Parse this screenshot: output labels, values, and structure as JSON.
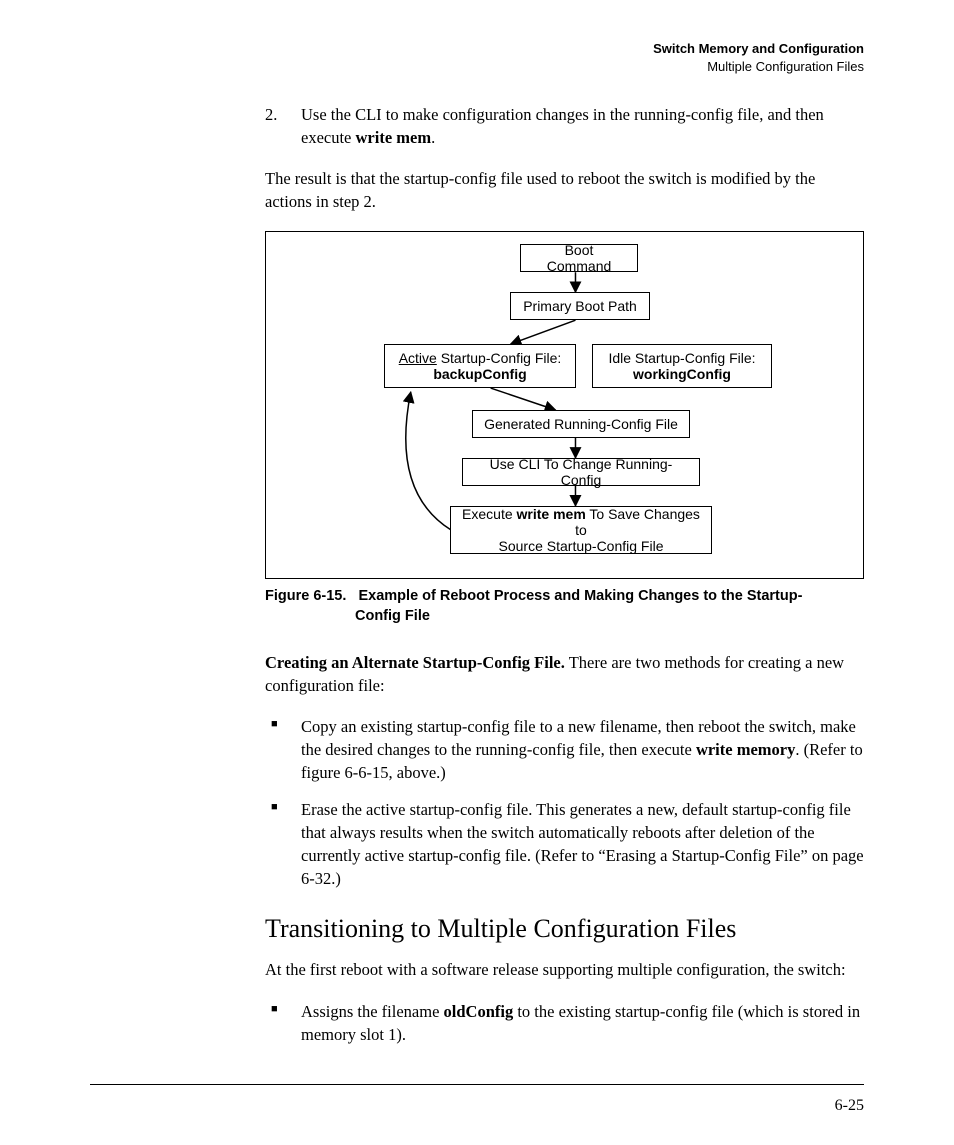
{
  "header": {
    "title_bold": "Switch Memory and Configuration",
    "subtitle": "Multiple Configuration Files"
  },
  "step2": {
    "num": "2.",
    "text_a": "Use the CLI to make configuration changes in the running-config file, and then execute ",
    "bold": "write mem",
    "text_b": "."
  },
  "result_para": "The result is that the startup-config file used to reboot the switch is modified by the actions in step 2.",
  "diagram": {
    "boot_command": "Boot Command",
    "primary_boot_path": "Primary Boot Path",
    "active_label_pre": "Active",
    "active_label_post": " Startup-Config File:",
    "active_name": "backupConfig",
    "idle_label": "Idle Startup-Config File:",
    "idle_name": "workingConfig",
    "generated": "Generated Running-Config File",
    "use_cli": "Use CLI To Change Running-Config",
    "exec_pre": "Execute ",
    "exec_bold": "write mem",
    "exec_post": " To Save Changes to",
    "exec_line2": "Source Startup-Config File"
  },
  "caption": {
    "label": "Figure 6-15.",
    "line1": "Example of Reboot Process and Making Changes to the Startup-",
    "line2": "Config File"
  },
  "alt_heading_bold": "Creating an Alternate Startup-Config File.",
  "alt_heading_rest": "  There are two methods for creating a new configuration file:",
  "bullet1_a": "Copy an existing startup-config file to a new filename, then reboot the switch, make the desired changes to the running-config file, then execute ",
  "bullet1_bold": "write memory",
  "bullet1_b": ". (Refer to figure 6-6-15, above.)",
  "bullet2": "Erase the active startup-config file. This generates a new, default startup-config file that always results when the switch automatically reboots after deletion of the currently active startup-config file. (Refer to “Erasing a Startup-Config File” on page 6-32.)",
  "section_heading": "Transitioning to Multiple Configuration Files",
  "trans_para": "At the first reboot with a software release supporting multiple configuration, the switch:",
  "bullet3_a": "Assigns the filename ",
  "bullet3_bold": "oldConfig",
  "bullet3_b": " to the existing startup-config file (which is stored in memory slot 1).",
  "page_num": "6-25"
}
